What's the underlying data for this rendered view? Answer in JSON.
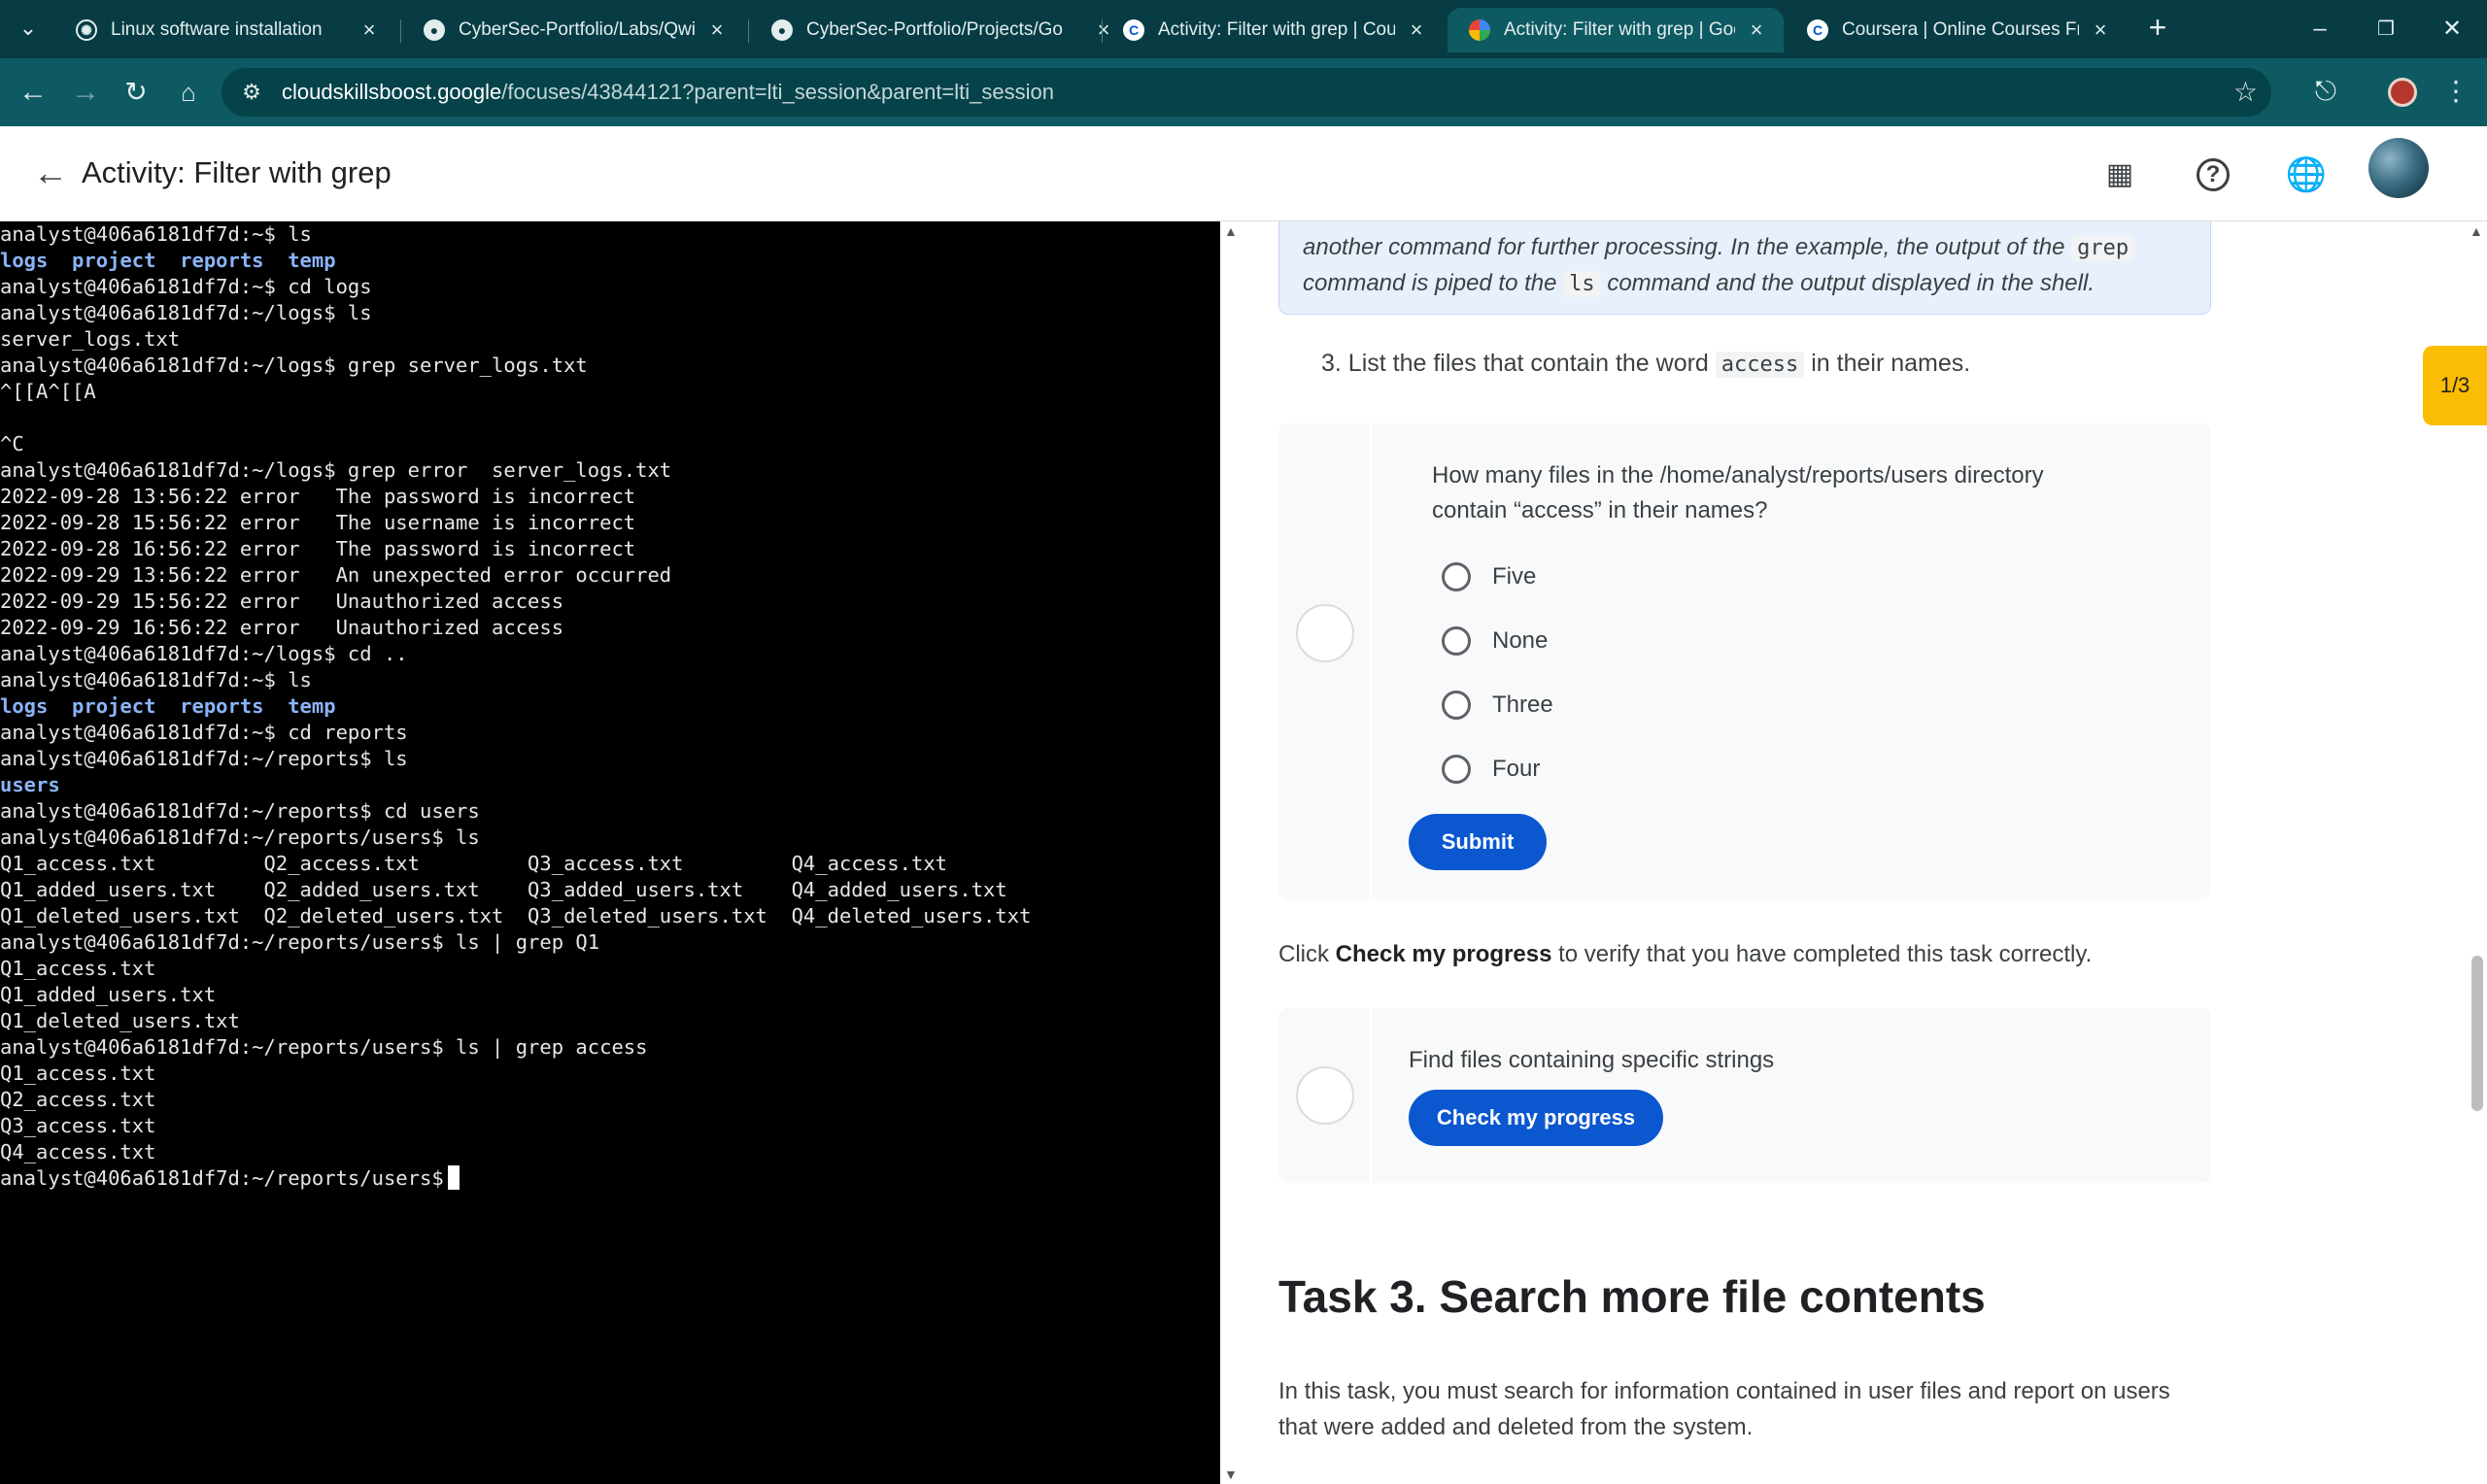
{
  "browser": {
    "tabs": [
      {
        "title": "Linux software installation",
        "icon": "openai-icon",
        "active": false
      },
      {
        "title": "CyberSec-Portfolio/Labs/Qwikla",
        "icon": "github-icon",
        "active": false
      },
      {
        "title": "CyberSec-Portfolio/Projects/Go",
        "icon": "github-icon",
        "active": false
      },
      {
        "title": "Activity: Filter with grep | Cours",
        "icon": "coursera-icon",
        "active": false
      },
      {
        "title": "Activity: Filter with grep | Googl",
        "icon": "cloud-skills-icon",
        "active": true
      },
      {
        "title": "Coursera | Online Courses From",
        "icon": "coursera-icon",
        "active": false
      }
    ],
    "url_host": "cloudskillsboost.google",
    "url_path": "/focuses/43844121?parent=lti_session&parent=lti_session"
  },
  "header": {
    "title": "Activity: Filter with grep"
  },
  "terminal": {
    "lines": [
      {
        "text": "analyst@406a6181df7d:~$ ls",
        "dir": false
      },
      {
        "text": "logs  project  reports  temp",
        "dir": true
      },
      {
        "text": "analyst@406a6181df7d:~$ cd logs",
        "dir": false
      },
      {
        "text": "analyst@406a6181df7d:~/logs$ ls",
        "dir": false
      },
      {
        "text": "server_logs.txt",
        "dir": false
      },
      {
        "text": "analyst@406a6181df7d:~/logs$ grep server_logs.txt",
        "dir": false
      },
      {
        "text": "^[[A^[[A",
        "dir": false
      },
      {
        "text": "",
        "dir": false
      },
      {
        "text": "^C",
        "dir": false
      },
      {
        "text": "analyst@406a6181df7d:~/logs$ grep error  server_logs.txt",
        "dir": false
      },
      {
        "text": "2022-09-28 13:56:22 error   The password is incorrect",
        "dir": false
      },
      {
        "text": "2022-09-28 15:56:22 error   The username is incorrect",
        "dir": false
      },
      {
        "text": "2022-09-28 16:56:22 error   The password is incorrect",
        "dir": false
      },
      {
        "text": "2022-09-29 13:56:22 error   An unexpected error occurred",
        "dir": false
      },
      {
        "text": "2022-09-29 15:56:22 error   Unauthorized access",
        "dir": false
      },
      {
        "text": "2022-09-29 16:56:22 error   Unauthorized access",
        "dir": false
      },
      {
        "text": "analyst@406a6181df7d:~/logs$ cd ..",
        "dir": false
      },
      {
        "text": "analyst@406a6181df7d:~$ ls",
        "dir": false
      },
      {
        "text": "logs  project  reports  temp",
        "dir": true
      },
      {
        "text": "analyst@406a6181df7d:~$ cd reports",
        "dir": false
      },
      {
        "text": "analyst@406a6181df7d:~/reports$ ls",
        "dir": false
      },
      {
        "text": "users",
        "dir": true
      },
      {
        "text": "analyst@406a6181df7d:~/reports$ cd users",
        "dir": false
      },
      {
        "text": "analyst@406a6181df7d:~/reports/users$ ls",
        "dir": false
      },
      {
        "text": "Q1_access.txt         Q2_access.txt         Q3_access.txt         Q4_access.txt",
        "dir": false
      },
      {
        "text": "Q1_added_users.txt    Q2_added_users.txt    Q3_added_users.txt    Q4_added_users.txt",
        "dir": false
      },
      {
        "text": "Q1_deleted_users.txt  Q2_deleted_users.txt  Q3_deleted_users.txt  Q4_deleted_users.txt",
        "dir": false
      },
      {
        "text": "analyst@406a6181df7d:~/reports/users$ ls | grep Q1",
        "dir": false
      },
      {
        "text": "Q1_access.txt",
        "dir": false
      },
      {
        "text": "Q1_added_users.txt",
        "dir": false
      },
      {
        "text": "Q1_deleted_users.txt",
        "dir": false
      },
      {
        "text": "analyst@406a6181df7d:~/reports/users$ ls | grep access",
        "dir": false
      },
      {
        "text": "Q1_access.txt",
        "dir": false
      },
      {
        "text": "Q2_access.txt",
        "dir": false
      },
      {
        "text": "Q3_access.txt",
        "dir": false
      },
      {
        "text": "Q4_access.txt",
        "dir": false
      }
    ],
    "prompt": "analyst@406a6181df7d:~/reports/users$"
  },
  "content": {
    "callout": {
      "line1_before": "another command for further processing. In the example, the output of the ",
      "line1_code": "grep",
      "line2_before": "command is piped to the ",
      "line2_code": "ls",
      "line2_after": " command and the output displayed in the shell."
    },
    "step": {
      "before": "3. List the files that contain the word ",
      "code": "access",
      "after": " in their names."
    },
    "quiz": {
      "question": "How many files in the /home/analyst/reports/users directory contain “access” in their names?",
      "options": [
        "Five",
        "None",
        "Three",
        "Four"
      ],
      "submit_label": "Submit"
    },
    "check_text": {
      "before": "Click ",
      "bold": "Check my progress",
      "after": " to verify that you have completed this task correctly."
    },
    "progress": {
      "label": "Find files containing specific strings",
      "button_label": "Check my progress"
    },
    "task_heading": "Task 3. Search more file contents",
    "task_intro": "In this task, you must search for information contained in user files and report on users that were added and deleted from the system."
  },
  "page_indicator": "1/3"
}
